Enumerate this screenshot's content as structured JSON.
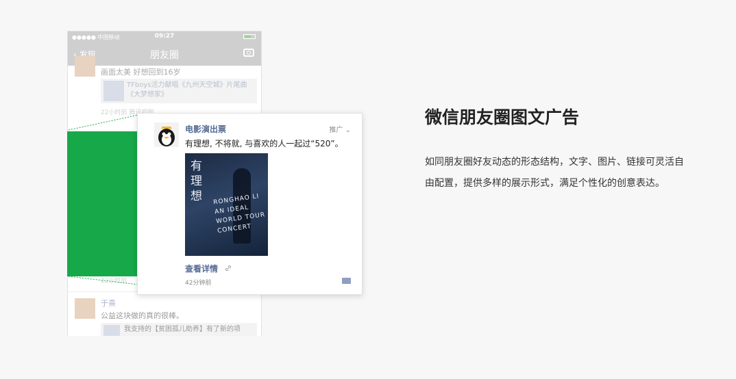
{
  "phone": {
    "status_carrier": "●●●●● 中国移动",
    "status_time": "09:27",
    "nav_back_label": "发现",
    "nav_title": "朋友圈"
  },
  "feed": [
    {
      "text": "画面太美 好想回到16岁",
      "link_title": "TFboys活力献唱《九州天空城》片尾曲《大梦想家》",
      "meta": "22小时前  腾讯视频"
    },
    {
      "meta": "22小时前"
    },
    {
      "nick": "于熹",
      "text": "公益这块做的真的很棒。",
      "link_title": "我支持的【贫困孤儿助养】有了新的项"
    }
  ],
  "ad_card": {
    "name": "电影演出票",
    "tag": "推广",
    "text": "有理想, 不将就, 与喜欢的人一起过“520”。",
    "poster_cn": "有理想",
    "poster_en": "RONGHAO LI AN IDEAL WORLD TOUR CONCERT",
    "view_detail": "查看详情",
    "time": "42分钟前"
  },
  "info": {
    "headline": "微信朋友圈图文广告",
    "description": "如同朋友圈好友动态的形态结构，文字、图片、链接可灵活自由配置，提供多样的展示形式，满足个性化的创意表达。"
  },
  "colors": {
    "accent_green": "#17a849",
    "link_blue": "#576b95"
  }
}
